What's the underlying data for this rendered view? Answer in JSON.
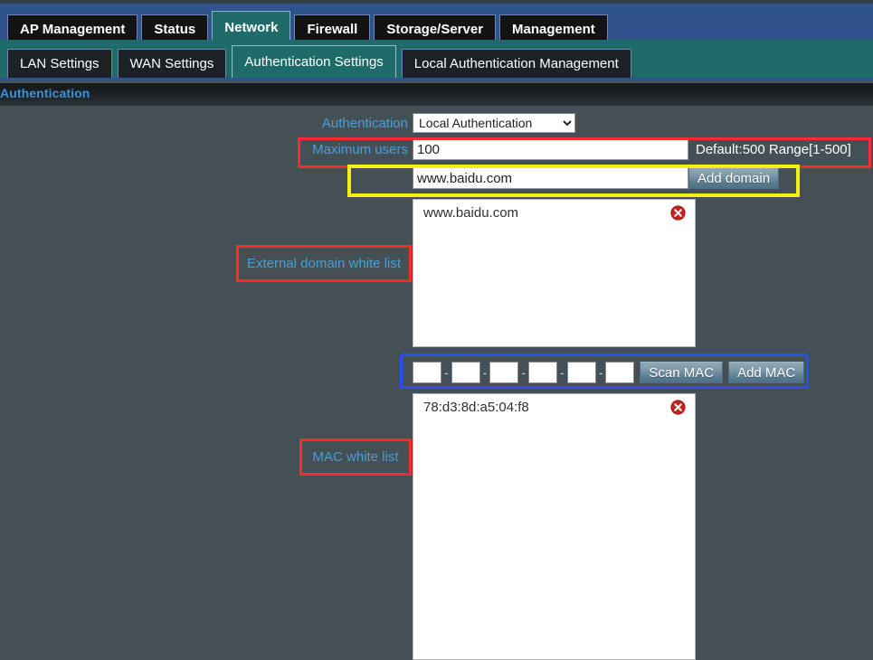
{
  "nav": {
    "top_tabs": [
      {
        "label": "AP Management",
        "active": false
      },
      {
        "label": "Status",
        "active": false
      },
      {
        "label": "Network",
        "active": true
      },
      {
        "label": "Firewall",
        "active": false
      },
      {
        "label": "Storage/Server",
        "active": false
      },
      {
        "label": "Management",
        "active": false
      }
    ],
    "sub_tabs": [
      {
        "label": "LAN Settings",
        "active": false
      },
      {
        "label": "WAN Settings",
        "active": false
      },
      {
        "label": "Authentication Settings",
        "active": true
      },
      {
        "label": "Local Authentication Management",
        "active": false
      }
    ]
  },
  "page": {
    "title": "Authentication"
  },
  "form": {
    "auth_label": "Authentication",
    "auth_selected": "Local Authentication",
    "auth_options": [
      "Local Authentication"
    ],
    "max_users_label": "Maximum users",
    "max_users_value": "100",
    "max_users_hint": "Default:500 Range[1-500]",
    "domain_input_value": "www.baidu.com",
    "add_domain_label": "Add domain",
    "mac_octets": [
      "",
      "",
      "",
      "",
      "",
      ""
    ],
    "mac_separator": "-",
    "scan_mac_label": "Scan MAC",
    "add_mac_label": "Add MAC"
  },
  "domain_white_list": {
    "annotation_label": "External domain white list",
    "items": [
      {
        "value": "www.baidu.com",
        "delete_icon": "delete-circle-icon"
      }
    ]
  },
  "mac_white_list": {
    "annotation_label": "MAC white list",
    "items": [
      {
        "value": "78:d3:8d:a5:04:f8",
        "delete_icon": "delete-circle-icon"
      }
    ]
  },
  "colors": {
    "topbar": "#31538d",
    "subbar": "#1f6b69",
    "page_background": "#454f56",
    "label_blue": "#4a9fd4",
    "title_blue": "#3a93d6",
    "annotation_red": "#fc2a2a",
    "annotation_yellow": "#f5ef16",
    "annotation_blue": "#2b4ff0",
    "delete_icon_red": "#c9211e"
  }
}
